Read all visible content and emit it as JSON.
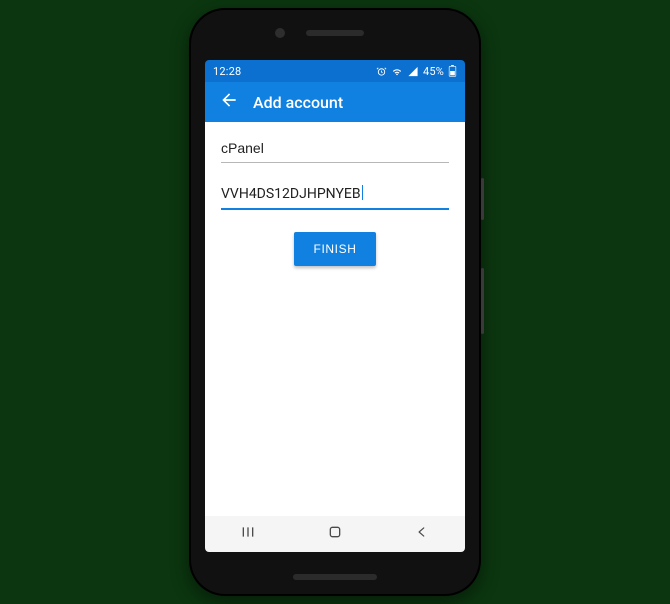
{
  "status": {
    "time": "12:28",
    "battery_text": "45%",
    "icons": {
      "alarm": "alarm-icon",
      "wifi": "wifi-icon",
      "signal": "signal-icon",
      "battery": "battery-icon"
    }
  },
  "appbar": {
    "title": "Add account",
    "back_icon": "arrow-back-icon"
  },
  "form": {
    "account_name": "cPanel",
    "secret_key": "VVH4DS12DJHPNYEB",
    "finish_label": "FINISH"
  },
  "nav": {
    "recents": "recents-icon",
    "home": "home-icon",
    "back": "nav-back-icon"
  },
  "colors": {
    "primary": "#1081e0",
    "primary_dark": "#0b70cf"
  }
}
